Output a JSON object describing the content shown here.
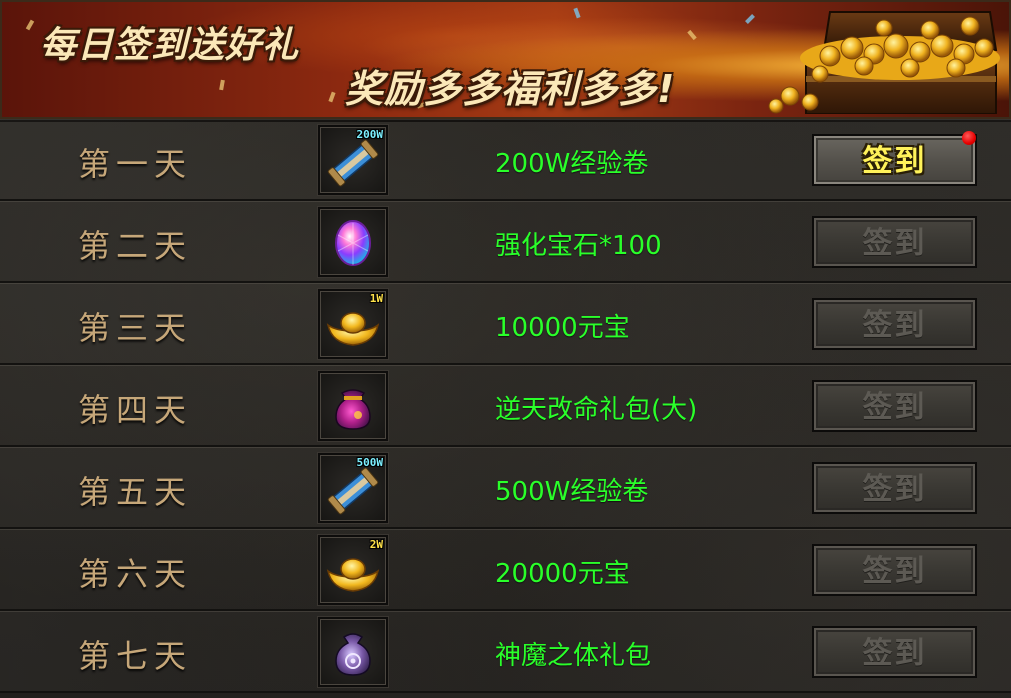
{
  "banner": {
    "title_line1": "每日签到送好礼",
    "title_line2": "奖励多多福利多多!"
  },
  "rows": [
    {
      "day": "第一天",
      "reward": "200W经验卷",
      "badge": "200W",
      "badge_color": "#7cf0ff",
      "icon": "scroll-icon",
      "button": "签到",
      "state": "available",
      "notify": true
    },
    {
      "day": "第二天",
      "reward": "强化宝石*100",
      "badge": "",
      "badge_color": "#ffffff",
      "icon": "gem-icon",
      "button": "签到",
      "state": "disabled",
      "notify": false
    },
    {
      "day": "第三天",
      "reward": "10000元宝",
      "badge": "1W",
      "badge_color": "#ffe24a",
      "icon": "gold-ingot-icon",
      "button": "签到",
      "state": "disabled",
      "notify": false
    },
    {
      "day": "第四天",
      "reward": "逆天改命礼包(大)",
      "badge": "",
      "badge_color": "#ffffff",
      "icon": "gift-bag-icon",
      "button": "签到",
      "state": "disabled",
      "notify": false
    },
    {
      "day": "第五天",
      "reward": "500W经验卷",
      "badge": "500W",
      "badge_color": "#7cf0ff",
      "icon": "scroll-icon",
      "button": "签到",
      "state": "disabled",
      "notify": false
    },
    {
      "day": "第六天",
      "reward": "20000元宝",
      "badge": "2W",
      "badge_color": "#ffe24a",
      "icon": "gold-ingot-icon",
      "button": "签到",
      "state": "disabled",
      "notify": false
    },
    {
      "day": "第七天",
      "reward": "神魔之体礼包",
      "badge": "",
      "badge_color": "#ffffff",
      "icon": "magic-pouch-icon",
      "button": "签到",
      "state": "disabled",
      "notify": false
    }
  ],
  "colors": {
    "reward_text": "#2aff2a",
    "day_text": "#c6a779",
    "active_button_text": "#fff25a",
    "notify_dot": "#e60000"
  }
}
